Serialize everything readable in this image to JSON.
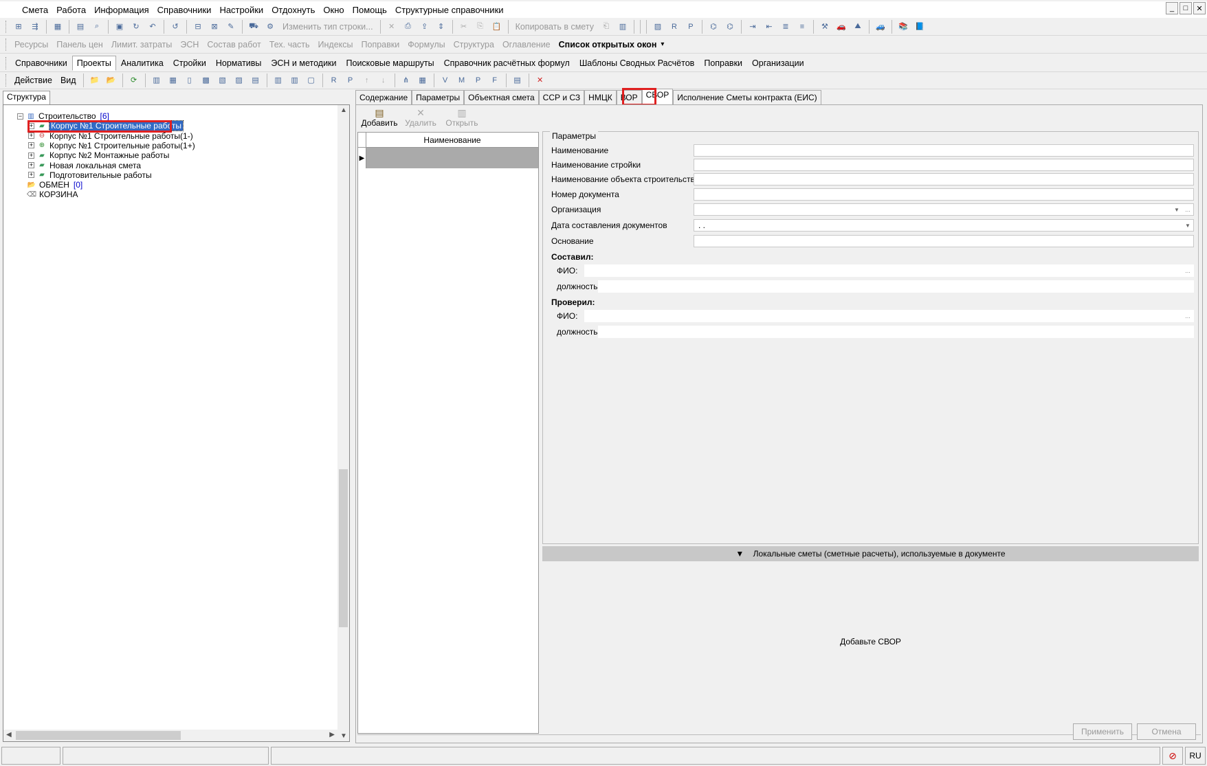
{
  "menu": [
    "Смета",
    "Работа",
    "Информация",
    "Справочники",
    "Настройки",
    "Отдохнуть",
    "Окно",
    "Помощь",
    "Структурные справочники"
  ],
  "window_controls": [
    "_",
    "□",
    "✕"
  ],
  "toolbar1": {
    "change_row_type": "Изменить тип строки...",
    "copy_to_estimate": "Копировать в смету"
  },
  "toolbar2": {
    "items": [
      "Ресурсы",
      "Панель цен",
      "Лимит. затраты",
      "ЭСН",
      "Состав работ",
      "Тех. часть",
      "Индексы",
      "Поправки",
      "Формулы",
      "Структура",
      "Оглавление"
    ],
    "open_windows": "Список открытых окон"
  },
  "module_tabs": [
    "Справочники",
    "Проекты",
    "Аналитика",
    "Стройки",
    "Нормативы",
    "ЭСН и методики",
    "Поисковые маршруты",
    "Справочник расчётных формул",
    "Шаблоны Сводных Расчётов",
    "Поправки",
    "Организации"
  ],
  "module_active": 1,
  "action_bar": {
    "action": "Действие",
    "view": "Вид"
  },
  "left_panel": {
    "tab": "Структура",
    "tree": [
      {
        "label": "Строительство",
        "count": "[6]",
        "level": 0,
        "icon": "building-icon"
      },
      {
        "label": "Корпус №1 Строительные работы",
        "level": 1,
        "icon": "estimate-book-icon",
        "selected": true
      },
      {
        "label": "Корпус №1 Строительные работы(1-)",
        "level": 1,
        "icon": "estimate-minus-icon"
      },
      {
        "label": "Корпус №1 Строительные работы(1+)",
        "level": 1,
        "icon": "estimate-plus-icon"
      },
      {
        "label": "Корпус №2 Монтажные работы",
        "level": 1,
        "icon": "estimate-book-icon"
      },
      {
        "label": "Новая локальная смета",
        "level": 1,
        "icon": "estimate-book-icon"
      },
      {
        "label": "Подготовительные работы",
        "level": 1,
        "icon": "estimate-book-icon"
      },
      {
        "label": "ОБМЕН",
        "count": "[0]",
        "level": 0,
        "icon": "folder-icon"
      },
      {
        "label": "КОРЗИНА",
        "level": 0,
        "icon": "trash-icon"
      }
    ]
  },
  "right_tabs": [
    "Содержание",
    "Параметры",
    "Объектная смета",
    "ССР и СЗ",
    "НМЦК",
    "ВОР",
    "СВОР",
    "Исполнение Сметы контракта (ЕИС)"
  ],
  "right_active": 6,
  "svor": {
    "buttons": {
      "add": "Добавить",
      "delete": "Удалить",
      "open": "Открыть"
    },
    "list_header": "Наименование",
    "params_legend": "Параметры",
    "fields": {
      "name": "Наименование",
      "construction_name": "Наименование стройки",
      "object_name": "Наименование объекта строительства",
      "doc_number": "Номер документа",
      "organization": "Организация",
      "doc_date": "Дата составления документов",
      "doc_date_value": " .  .",
      "basis": "Основание"
    },
    "composed": {
      "title": "Составил:",
      "fio": "ФИО:",
      "position": "должность:"
    },
    "checked": {
      "title": "Проверил:",
      "fio": "ФИО:",
      "position": "должность:"
    },
    "local_estimates_header": "Локальные сметы (сметные расчеты), используемые в документе",
    "empty_message": "Добавьте СВОР",
    "apply": "Применить",
    "cancel": "Отмена"
  },
  "status": {
    "lang": "RU"
  }
}
